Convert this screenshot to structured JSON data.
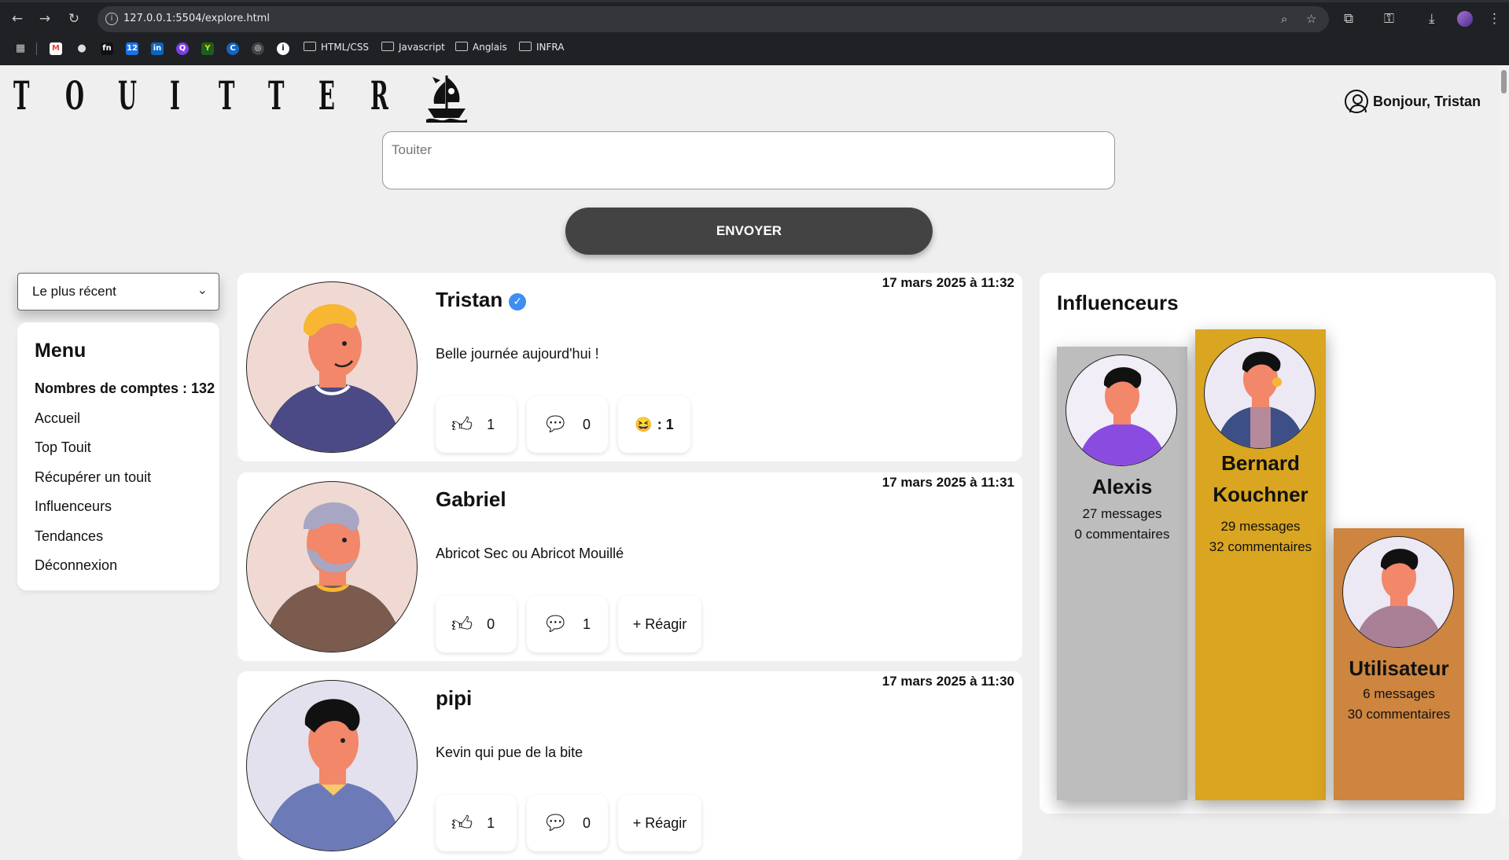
{
  "browser": {
    "url": "127.0.0.1:5504/explore.html",
    "bookmarks": [
      "HTML/CSS",
      "Javascript",
      "Anglais",
      "INFRA"
    ]
  },
  "header": {
    "logo_letters": [
      "T",
      "O",
      "U",
      "I",
      "T",
      "T",
      "E",
      "R"
    ],
    "greeting": "Bonjour, Tristan"
  },
  "compose": {
    "placeholder": "Touiter",
    "send_label": "ENVOYER"
  },
  "sort": {
    "selected": "Le plus récent"
  },
  "menu": {
    "title": "Menu",
    "accounts_count": "Nombres de comptes : 132",
    "items": [
      "Accueil",
      "Top Touit",
      "Récupérer un touit",
      "Influenceurs",
      "Tendances",
      "Déconnexion"
    ]
  },
  "posts": [
    {
      "author": "Tristan",
      "verified": true,
      "date": "17 mars 2025 à 11:32",
      "text": "Belle journée aujourd'hui !",
      "likes": "1",
      "comments": "0",
      "reaction": ": 1"
    },
    {
      "author": "Gabriel",
      "verified": false,
      "date": "17 mars 2025 à 11:31",
      "text": "Abricot Sec ou Abricot Mouillé",
      "likes": "0",
      "comments": "1",
      "reaction": "+ Réagir"
    },
    {
      "author": "pipi",
      "verified": false,
      "date": "17 mars 2025 à 11:30",
      "text": "Kevin qui pue de la bite",
      "likes": "1",
      "comments": "0",
      "reaction": "+ Réagir"
    }
  ],
  "influencers": {
    "title": "Influenceurs",
    "list": [
      {
        "name": "Alexis",
        "messages": "27 messages",
        "comments": "0 commentaires",
        "color": "#bdbdbd"
      },
      {
        "name": "Bernard Kouchner",
        "name_line1": "Bernard",
        "name_line2": "Kouchner",
        "messages": "29 messages",
        "comments": "32 commentaires",
        "color": "#daa520"
      },
      {
        "name": "Utilisateur",
        "messages": "6 messages",
        "comments": "30 commentaires",
        "color": "#cd853f"
      }
    ]
  },
  "colors": {
    "send_button": "#434343",
    "verified": "#3d8ef0",
    "background": "#efefef"
  }
}
